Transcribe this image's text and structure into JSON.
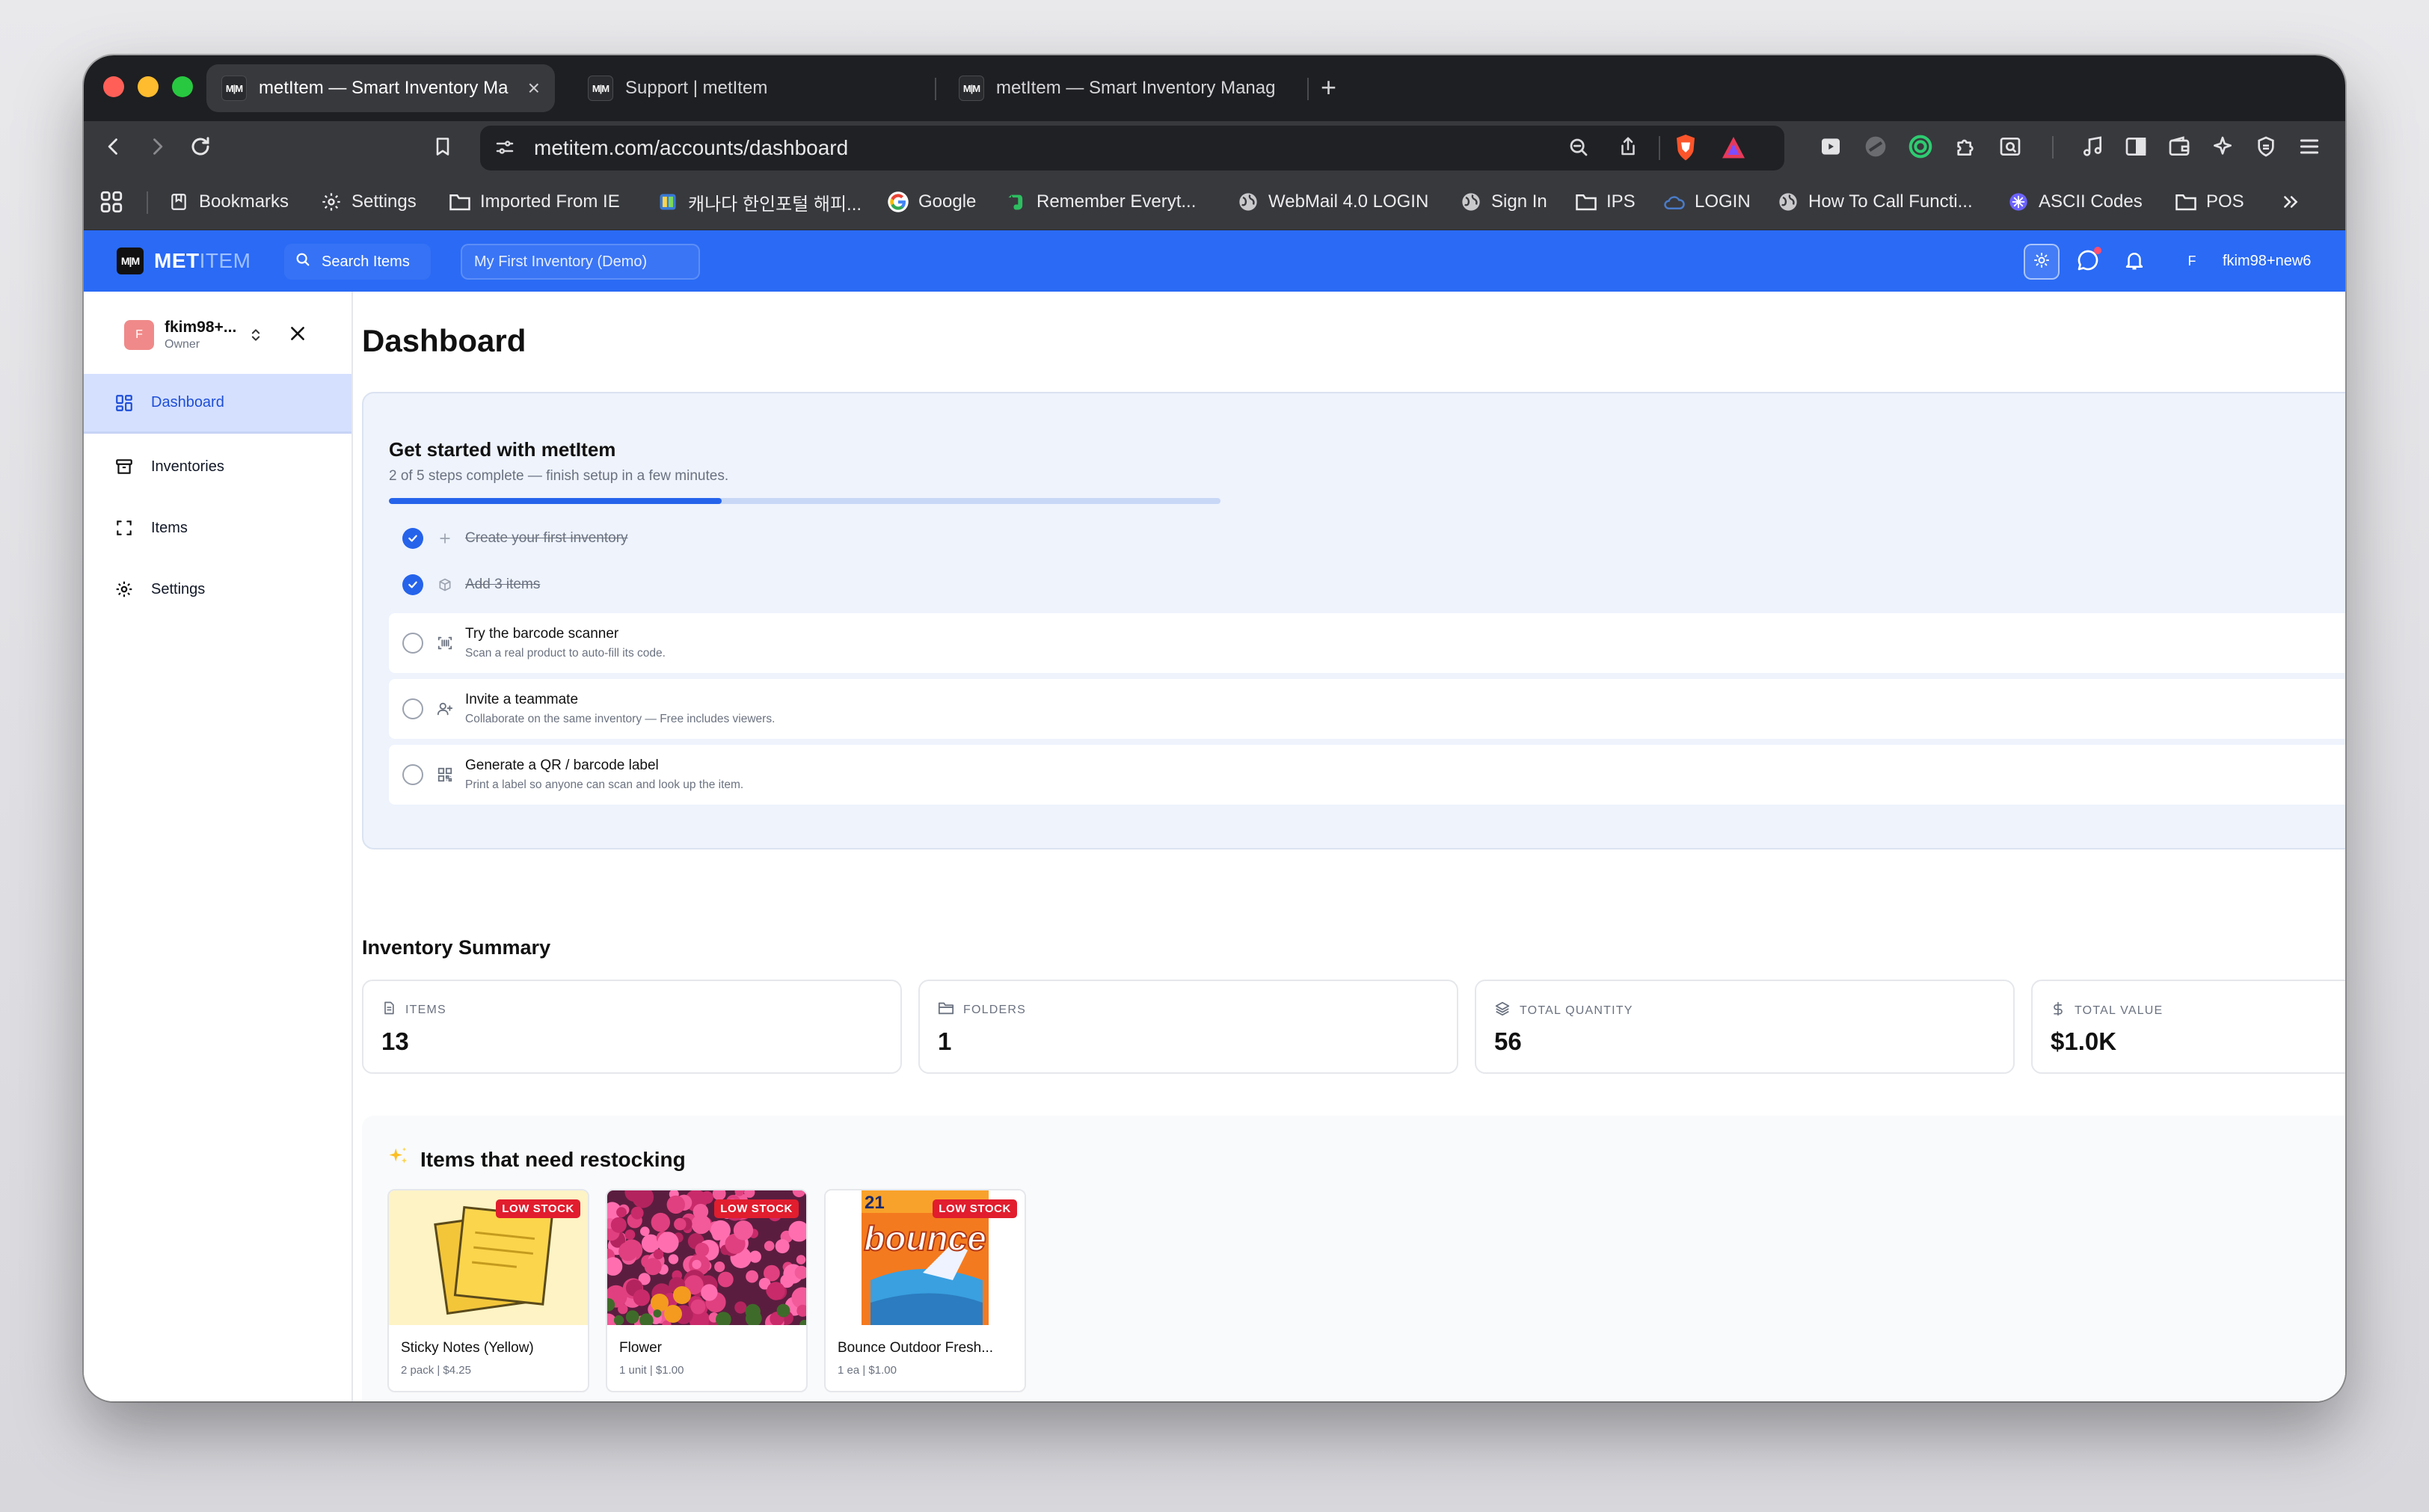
{
  "browser": {
    "tabs": [
      {
        "favicon": "M|M",
        "title": "metItem — Smart Inventory Ma",
        "active": true
      },
      {
        "favicon": "M|M",
        "title": "Support | metItem",
        "active": false
      },
      {
        "favicon": "M|M",
        "title": "metItem — Smart Inventory Manag",
        "active": false
      }
    ],
    "url": "metitem.com/accounts/dashboard",
    "bookmarks": [
      {
        "label": "Bookmarks",
        "icon": "bookmark-icon"
      },
      {
        "label": "Settings",
        "icon": "gear-icon"
      },
      {
        "label": "Imported From IE",
        "icon": "folder-icon"
      },
      {
        "label": "캐나다 한인포털 해피...",
        "icon": "site-icon"
      },
      {
        "label": "Google",
        "icon": "google-icon"
      },
      {
        "label": "Remember Everyt...",
        "icon": "evernote-icon"
      },
      {
        "label": "WebMail 4.0 LOGIN",
        "icon": "globe-icon"
      },
      {
        "label": "Sign In",
        "icon": "globe-icon"
      },
      {
        "label": "IPS",
        "icon": "folder-icon"
      },
      {
        "label": "LOGIN",
        "icon": "cloud-icon"
      },
      {
        "label": "How To Call Functi...",
        "icon": "globe-icon"
      },
      {
        "label": "ASCII Codes",
        "icon": "site-icon"
      },
      {
        "label": "POS",
        "icon": "folder-icon"
      }
    ]
  },
  "header": {
    "logo_mark": "M|M",
    "logo_main": "MET",
    "logo_dim": "ITEM",
    "search_label": "Search Items",
    "inventory_selector": "My First Inventory (Demo)",
    "user_initial": "F",
    "user_name": "fkim98+new6"
  },
  "sidebar": {
    "account": {
      "initial": "F",
      "name": "fkim98+...",
      "role": "Owner"
    },
    "items": [
      {
        "label": "Dashboard",
        "icon": "dashboard-grid-icon",
        "active": true
      },
      {
        "label": "Inventories",
        "icon": "archive-box-icon",
        "active": false
      },
      {
        "label": "Items",
        "icon": "scan-frame-icon",
        "active": false
      },
      {
        "label": "Settings",
        "icon": "gear-icon",
        "active": false
      }
    ]
  },
  "dashboard": {
    "title": "Dashboard",
    "getting_started": {
      "title": "Get started with metItem",
      "subtitle": "2 of 5 steps complete — finish setup in a few minutes.",
      "progress": 0.4,
      "steps": [
        {
          "title": "Create your first inventory",
          "description": "",
          "done": true,
          "icon": "plus-icon"
        },
        {
          "title": "Add 3 items",
          "description": "",
          "done": true,
          "icon": "box-icon"
        },
        {
          "title": "Try the barcode scanner",
          "description": "Scan a real product to auto-fill its code.",
          "done": false,
          "icon": "barcode-scan-icon"
        },
        {
          "title": "Invite a teammate",
          "description": "Collaborate on the same inventory — Free includes viewers.",
          "done": false,
          "icon": "user-plus-icon"
        },
        {
          "title": "Generate a QR / barcode label",
          "description": "Print a label so anyone can scan and look up the item.",
          "done": false,
          "icon": "qr-code-icon"
        }
      ]
    },
    "summary": {
      "title": "Inventory Summary",
      "stats": [
        {
          "label": "ITEMS",
          "value": "13",
          "icon": "document-icon"
        },
        {
          "label": "FOLDERS",
          "value": "1",
          "icon": "folder-icon"
        },
        {
          "label": "TOTAL QUANTITY",
          "value": "56",
          "icon": "layers-icon"
        },
        {
          "label": "TOTAL VALUE",
          "value": "$1.0K",
          "icon": "dollar-icon"
        }
      ]
    },
    "restock": {
      "title": "Items that need restocking",
      "icon": "sparkles-icon",
      "badge": "LOW STOCK",
      "items": [
        {
          "name": "Sticky Notes (Yellow)",
          "meta": "2 pack | $4.25",
          "image": "sticky-notes-image"
        },
        {
          "name": "Flower",
          "meta": "1 unit | $1.00",
          "image": "flower-image"
        },
        {
          "name": "Bounce Outdoor Fresh...",
          "meta": "1 ea | $1.00",
          "image": "bounce-box-image",
          "image_text": "bounce",
          "image_count": "21"
        }
      ]
    }
  },
  "colors": {
    "brand_blue": "#2a6af5",
    "progress_blue": "#2563eb",
    "low_stock_red": "#e11d2e",
    "active_nav_bg": "#d5e0ff"
  }
}
